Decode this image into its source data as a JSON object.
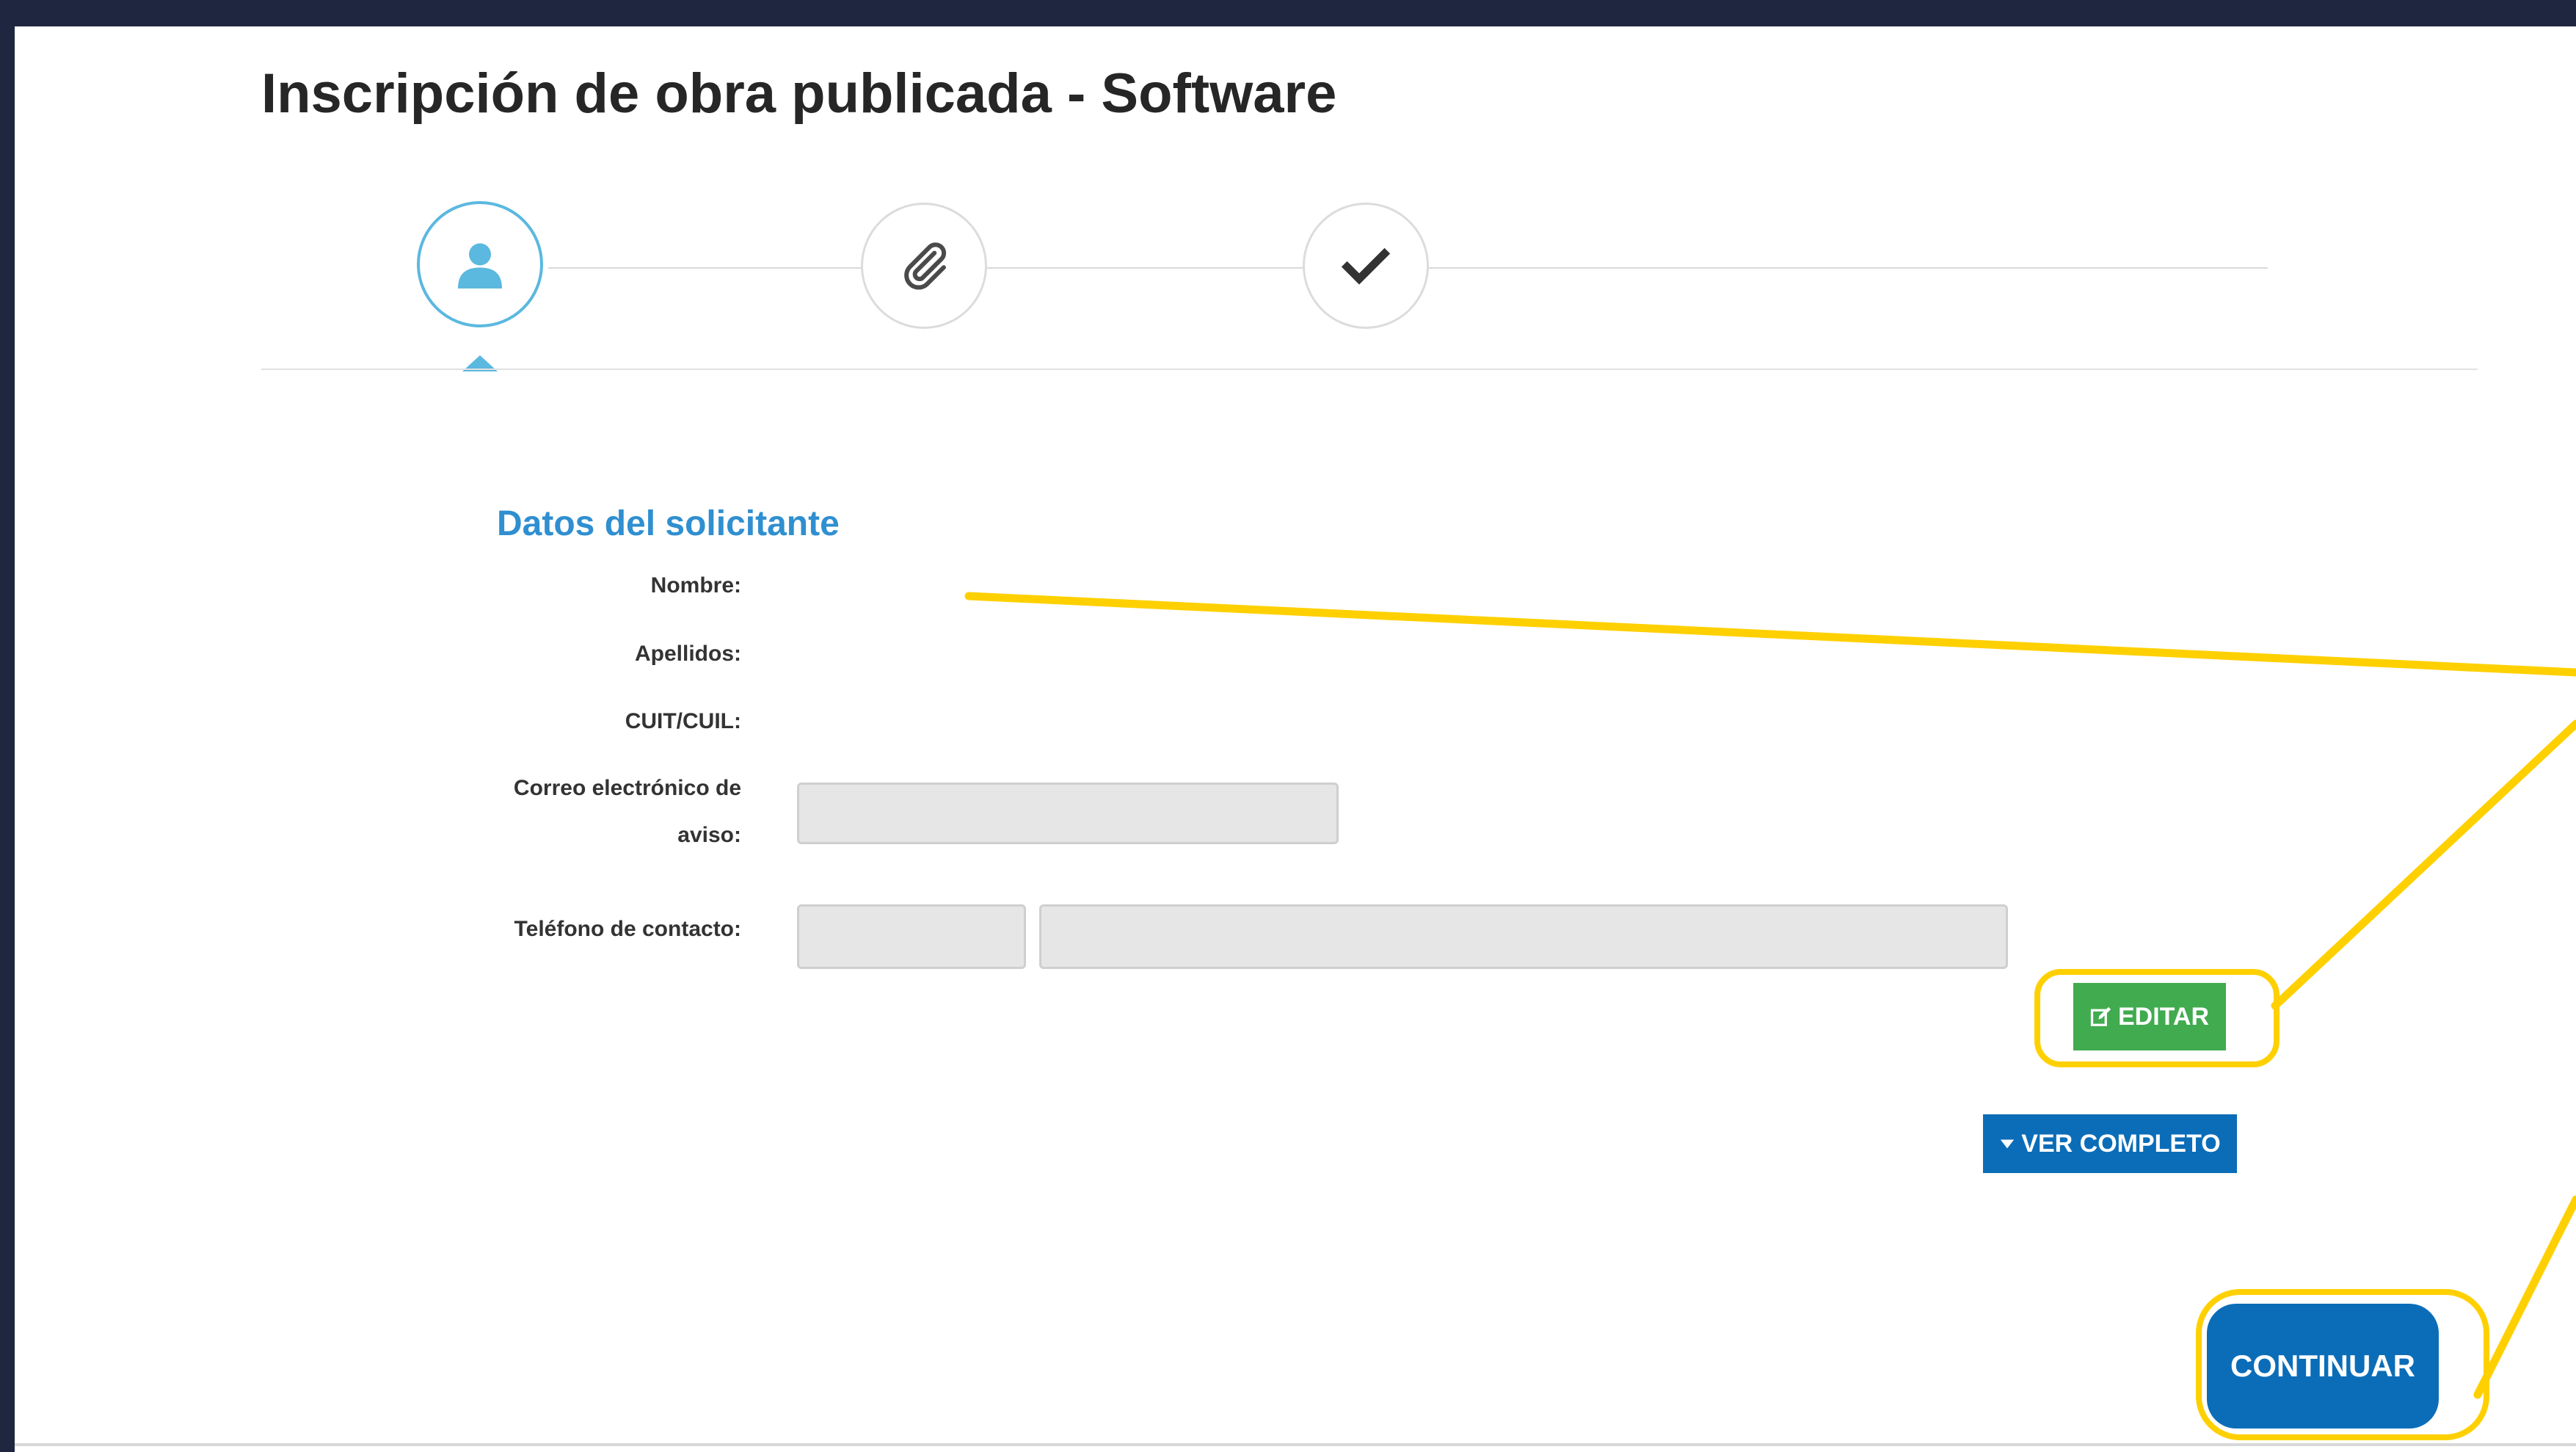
{
  "page": {
    "title": "Inscripción de obra publicada - Software"
  },
  "stepper": {
    "steps": [
      {
        "icon": "user-icon",
        "state": "active"
      },
      {
        "icon": "paperclip-icon",
        "state": "pending"
      },
      {
        "icon": "checkmark-icon",
        "state": "pending"
      }
    ]
  },
  "section": {
    "title": "Datos del solicitante"
  },
  "form": {
    "nombre_label": "Nombre:",
    "apellidos_label": "Apellidos:",
    "cuit_label": "CUIT/CUIL:",
    "email_label": "Correo electrónico de aviso:",
    "email_value": "",
    "phone_label": "Teléfono de contacto:",
    "phone_area_value": "",
    "phone_number_value": ""
  },
  "buttons": {
    "edit_label": "EDITAR",
    "ver_completo_label": "VER COMPLETO",
    "continue_label": "CONTINUAR"
  },
  "colors": {
    "accent_blue": "#0b6db8",
    "section_title_blue": "#2f8fd0",
    "edit_green": "#40ab4f",
    "highlight_yellow": "#ffd000",
    "step_active": "#5bb8df"
  }
}
